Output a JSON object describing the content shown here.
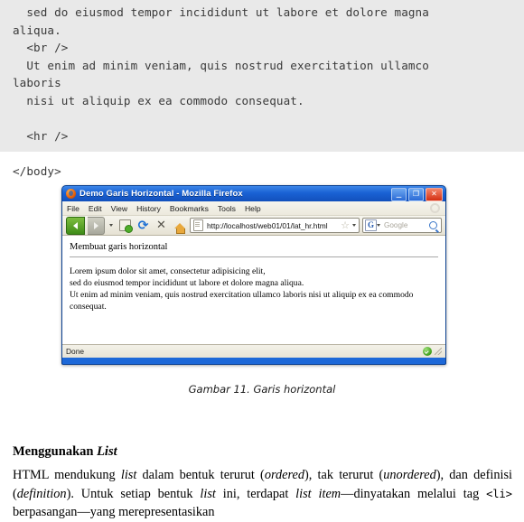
{
  "code_block": {
    "lines": [
      "  sed do eiusmod tempor incididunt ut labore et dolore magna",
      "aliqua.",
      "  <br />",
      "  Ut enim ad minim veniam, quis nostrud exercitation ullamco",
      "laboris",
      "  nisi ut aliquip ex ea commodo consequat.",
      "",
      "  <hr />",
      "",
      "</body>"
    ]
  },
  "browser": {
    "title": "Demo Garis Horizontal - Mozilla Firefox",
    "window_controls": {
      "minimize": "_",
      "maximize": "❐",
      "close": "✕"
    },
    "menu": [
      "File",
      "Edit",
      "View",
      "History",
      "Bookmarks",
      "Tools",
      "Help"
    ],
    "toolbar": {
      "back": "back-arrow",
      "forward": "forward-arrow",
      "dropdown": "caret",
      "bookmark": "bookmark-add-icon",
      "reload": "⟳",
      "stop": "✕",
      "home": "home-icon"
    },
    "url": "http://localhost/web01/01/lat_hr.html",
    "star": "☆",
    "search": {
      "engine_label": "G",
      "placeholder": "Google"
    },
    "page": {
      "heading": "Membuat garis horizontal",
      "lines": [
        "Lorem ipsum dolor sit amet, consectetur adipisicing elit,",
        "sed do eiusmod tempor incididunt ut labore et dolore magna aliqua.",
        "Ut enim ad minim veniam, quis nostrud exercitation ullamco laboris nisi ut aliquip ex ea commodo",
        "consequat."
      ]
    },
    "status": {
      "text": "Done",
      "security_icon": "secure-check-icon"
    }
  },
  "caption": "Gambar 11. Garis horizontal",
  "section": {
    "heading_plain": "Menggunakan ",
    "heading_italic": "List"
  },
  "paragraph": {
    "p1": "HTML mendukung ",
    "i1": "list",
    "p2": " dalam bentuk terurut (",
    "i2": "ordered",
    "p3": "), tak terurut (",
    "i3": "unordered",
    "p4": "), dan definisi (",
    "i4": "definition",
    "p5": "). Untuk setiap bentuk ",
    "i5": "list",
    "p6": " ini, terdapat ",
    "i6": "list item",
    "p7": "—dinyatakan melalui tag ",
    "tag": "<li>",
    "p8": " berpasangan—yang merepresentasikan"
  }
}
